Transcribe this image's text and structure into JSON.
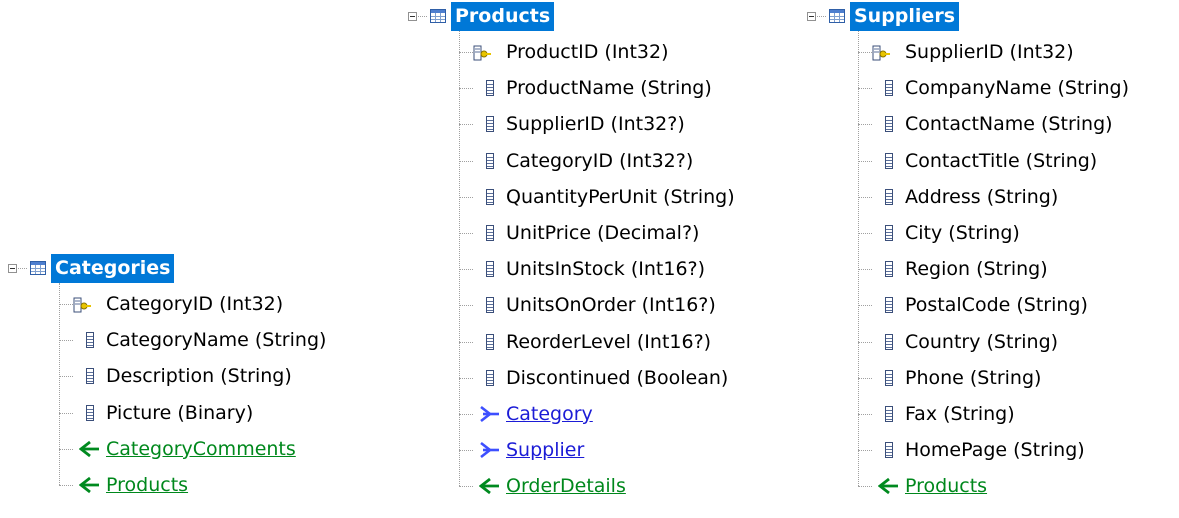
{
  "colors": {
    "selection": "#0078d7",
    "nav_forward": "#1b1bd6",
    "nav_collection": "#00881c",
    "tree_line": "#a0a0a0"
  },
  "entities": [
    {
      "name": "Categories",
      "properties": [
        {
          "label": "CategoryID (Int32)",
          "kind": "key"
        },
        {
          "label": "CategoryName (String)",
          "kind": "property"
        },
        {
          "label": "Description (String)",
          "kind": "property"
        },
        {
          "label": "Picture (Binary)",
          "kind": "property"
        }
      ],
      "navigations": [
        {
          "label": "CategoryComments",
          "kind": "collection"
        },
        {
          "label": "Products",
          "kind": "collection"
        }
      ]
    },
    {
      "name": "Products",
      "properties": [
        {
          "label": "ProductID (Int32)",
          "kind": "key"
        },
        {
          "label": "ProductName (String)",
          "kind": "property"
        },
        {
          "label": "SupplierID (Int32?)",
          "kind": "property"
        },
        {
          "label": "CategoryID (Int32?)",
          "kind": "property"
        },
        {
          "label": "QuantityPerUnit (String)",
          "kind": "property"
        },
        {
          "label": "UnitPrice (Decimal?)",
          "kind": "property"
        },
        {
          "label": "UnitsInStock (Int16?)",
          "kind": "property"
        },
        {
          "label": "UnitsOnOrder (Int16?)",
          "kind": "property"
        },
        {
          "label": "ReorderLevel (Int16?)",
          "kind": "property"
        },
        {
          "label": "Discontinued (Boolean)",
          "kind": "property"
        }
      ],
      "navigations": [
        {
          "label": "Category",
          "kind": "reference"
        },
        {
          "label": "Supplier",
          "kind": "reference"
        },
        {
          "label": "OrderDetails",
          "kind": "collection"
        }
      ]
    },
    {
      "name": "Suppliers",
      "properties": [
        {
          "label": "SupplierID (Int32)",
          "kind": "key"
        },
        {
          "label": "CompanyName (String)",
          "kind": "property"
        },
        {
          "label": "ContactName (String)",
          "kind": "property"
        },
        {
          "label": "ContactTitle (String)",
          "kind": "property"
        },
        {
          "label": "Address (String)",
          "kind": "property"
        },
        {
          "label": "City (String)",
          "kind": "property"
        },
        {
          "label": "Region (String)",
          "kind": "property"
        },
        {
          "label": "PostalCode (String)",
          "kind": "property"
        },
        {
          "label": "Country (String)",
          "kind": "property"
        },
        {
          "label": "Phone (String)",
          "kind": "property"
        },
        {
          "label": "Fax (String)",
          "kind": "property"
        },
        {
          "label": "HomePage (String)",
          "kind": "property"
        }
      ],
      "navigations": [
        {
          "label": "Products",
          "kind": "collection"
        }
      ]
    }
  ]
}
